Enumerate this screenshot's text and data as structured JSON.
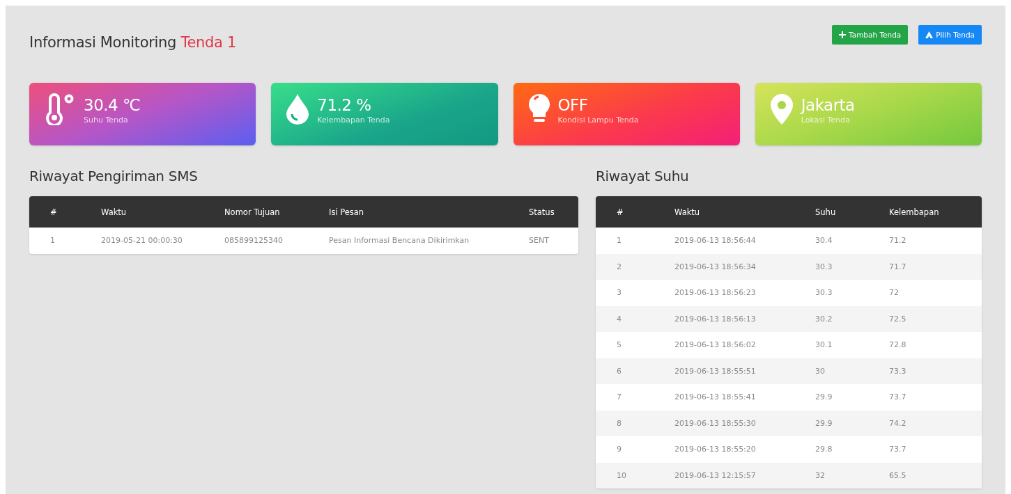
{
  "header": {
    "title": "Informasi Monitoring",
    "title_highlight": "Tenda 1"
  },
  "buttons": [
    {
      "label": "Tambah Tenda",
      "kind": "add"
    },
    {
      "label": "Pilih Tenda",
      "kind": "select"
    }
  ],
  "cards": [
    {
      "kind": "temperature",
      "value": "30.4 ℃",
      "label": "Suhu Tenda"
    },
    {
      "kind": "humidity",
      "value": "71.2 %",
      "label": "Kelembapan Tenda"
    },
    {
      "kind": "lamp",
      "value": "OFF",
      "label": "Kondisi Lampu Tenda"
    },
    {
      "kind": "location",
      "value": "Jakarta",
      "label": "Lokasi Tenda"
    }
  ],
  "sms_history": {
    "title": "Riwayat Pengiriman SMS",
    "columns": [
      "#",
      "Waktu",
      "Nomor Tujuan",
      "Isi Pesan",
      "Status"
    ],
    "rows": [
      [
        "1",
        "2019-05-21 00:00:30",
        "085899125340",
        "Pesan Informasi Bencana Dikirimkan",
        "SENT"
      ]
    ]
  },
  "temperature_history": {
    "title": "Riwayat Suhu",
    "columns": [
      "#",
      "Waktu",
      "Suhu",
      "Kelembapan"
    ],
    "rows": [
      [
        "1",
        "2019-06-13 18:56:44",
        "30.4",
        "71.2"
      ],
      [
        "2",
        "2019-06-13 18:56:34",
        "30.3",
        "71.7"
      ],
      [
        "3",
        "2019-06-13 18:56:23",
        "30.3",
        "72"
      ],
      [
        "4",
        "2019-06-13 18:56:13",
        "30.2",
        "72.5"
      ],
      [
        "5",
        "2019-06-13 18:56:02",
        "30.1",
        "72.8"
      ],
      [
        "6",
        "2019-06-13 18:55:51",
        "30",
        "73.3"
      ],
      [
        "7",
        "2019-06-13 18:55:41",
        "29.9",
        "73.7"
      ],
      [
        "8",
        "2019-06-13 18:55:30",
        "29.9",
        "74.2"
      ],
      [
        "9",
        "2019-06-13 18:55:20",
        "29.8",
        "73.7"
      ],
      [
        "10",
        "2019-06-13 12:15:57",
        "32",
        "65.5"
      ]
    ]
  }
}
